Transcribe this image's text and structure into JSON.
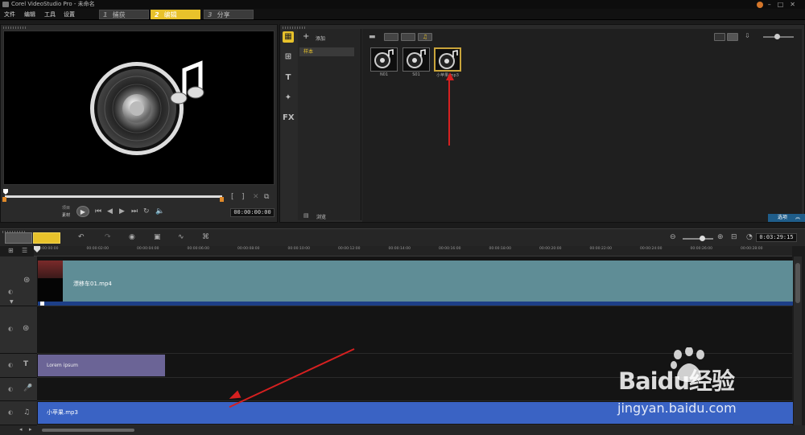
{
  "window": {
    "title": "Corel VideoStudio Pro - 未命名"
  },
  "menu": {
    "items": [
      "文件",
      "编辑",
      "工具",
      "设置"
    ]
  },
  "steps": [
    {
      "num": "1",
      "label": "捕获"
    },
    {
      "num": "2",
      "label": "编辑"
    },
    {
      "num": "3",
      "label": "分享"
    }
  ],
  "player": {
    "project_label": "项目",
    "clip_label": "素材",
    "timecode": "00:00:00:00"
  },
  "library": {
    "add_label": "添加",
    "folder": "样本",
    "browse_label": "浏览",
    "options_label": "选项",
    "items": [
      "N01",
      "S01",
      "小苹果.mp3"
    ]
  },
  "timeline": {
    "duration": "0:03:29:15",
    "ruler": [
      "00:00:00:00",
      "00:00:02:00",
      "00:00:04:00",
      "00:00:06:00",
      "00:00:08:00",
      "00:00:10:00",
      "00:00:12:00",
      "00:00:14:00",
      "00:00:16:00",
      "00:00:18:00",
      "00:00:20:00",
      "00:00:22:00",
      "00:00:24:00",
      "00:00:26:00",
      "00:00:28:00"
    ],
    "video_clip": "漂移车01.mp4",
    "title_clip": "Lorem ipsum",
    "music_clip": "小苹果.mp3"
  },
  "watermark": {
    "brand": "Baidu经验",
    "url": "jingyan.baidu.com"
  },
  "colors": {
    "accent": "#e8c22b",
    "video_clip": "#5f8d96",
    "title_clip": "#6b6496",
    "music_clip": "#3a63c4",
    "annotation": "#d62020"
  }
}
